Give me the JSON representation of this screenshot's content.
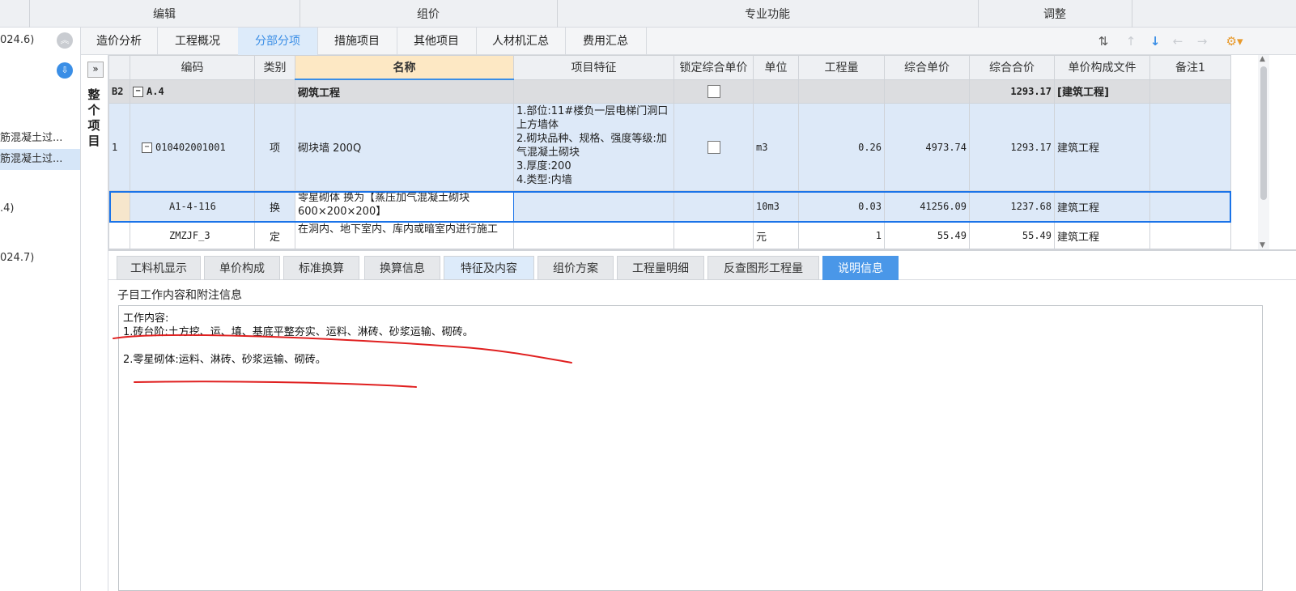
{
  "ribbon": {
    "groups": [
      "编辑",
      "组价",
      "专业功能",
      "调整"
    ]
  },
  "left_panel": {
    "top_text": "024.6)",
    "items": [
      "筋混凝土过...",
      "筋混凝土过...",
      ".4)",
      "024.7)"
    ],
    "collapse_icon": "double-chevron-up-icon",
    "download_icon": "download-icon"
  },
  "tabs": [
    "造价分析",
    "工程概况",
    "分部分项",
    "措施项目",
    "其他项目",
    "人材机汇总",
    "费用汇总"
  ],
  "active_tab": "分部分项",
  "toolbar_icons": [
    "sort-icon",
    "move-up-icon",
    "move-down-icon",
    "move-left-icon",
    "move-right-icon",
    "settings-icon"
  ],
  "side_expand": {
    "arrow": "»",
    "title": "整个项目"
  },
  "grid": {
    "headers": [
      "",
      "编码",
      "类别",
      "名称",
      "项目特征",
      "锁定综合单价",
      "单位",
      "工程量",
      "综合单价",
      "综合合价",
      "单价构成文件",
      "备注1"
    ],
    "group_row": {
      "index": "B2",
      "toggle": "−",
      "code": "A.4",
      "name": "砌筑工程",
      "total": "1293.17",
      "file": "[建筑工程]"
    },
    "rows": [
      {
        "index": "1",
        "toggle": "−",
        "code": "010402001001",
        "type": "项",
        "name": "砌块墙 200Q",
        "features": [
          "1.部位:11#楼负一层电梯门洞口上方墙体",
          "2.砌块品种、规格、强度等级:加气混凝土砌块",
          "3.厚度:200",
          "4.类型:内墙"
        ],
        "unit": "m3",
        "quantity": "0.26",
        "unit_price": "4973.74",
        "total_price": "1293.17",
        "file": "建筑工程"
      },
      {
        "index": "",
        "code": "A1-4-116",
        "type": "换",
        "name": "零星砌体  换为【蒸压加气混凝土砌块600×200×200】",
        "unit": "10m3",
        "quantity": "0.03",
        "unit_price": "41256.09",
        "total_price": "1237.68",
        "file": "建筑工程"
      },
      {
        "index": "",
        "code": "ZMZJF_3",
        "type": "定",
        "name": "在洞内、地下室内、库内或暗室内进行施工",
        "unit": "元",
        "quantity": "1",
        "unit_price": "55.49",
        "total_price": "55.49",
        "file": "建筑工程"
      }
    ]
  },
  "bottom_tabs": [
    "工料机显示",
    "单价构成",
    "标准换算",
    "换算信息",
    "特征及内容",
    "组价方案",
    "工程量明细",
    "反查图形工程量",
    "说明信息"
  ],
  "bottom_active": "说明信息",
  "description": {
    "title": "子目工作内容和附注信息",
    "lines": [
      "工作内容:",
      "1.砖台阶:土方挖、运、填、基底平整夯实、运料、淋砖、砂浆运输、砌砖。",
      "2.零星砌体:运料、淋砖、砂浆运输、砌砖。"
    ]
  },
  "colors": {
    "accent": "#3a8ee6",
    "row_highlight": "#dde9f8",
    "annotation": "#e02020"
  }
}
